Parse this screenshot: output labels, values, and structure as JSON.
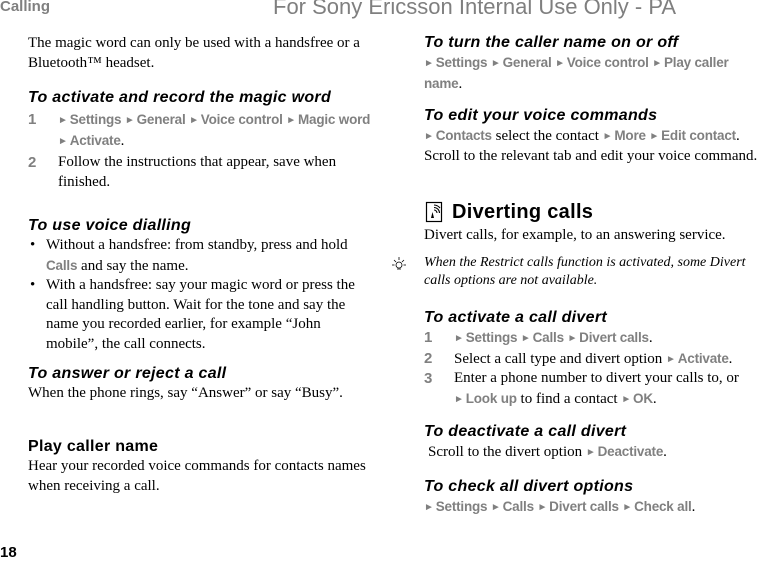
{
  "header": {
    "section": "Calling",
    "watermark": "For Sony Ericsson Internal Use Only - PA"
  },
  "footer": {
    "page_number": "18"
  },
  "left": {
    "intro": "The magic word can only be used with a handsfree or a Bluetooth™ headset.",
    "activate_magic": {
      "heading": "To activate and record the magic word",
      "step1": {
        "num": "1",
        "items": [
          "Settings",
          "General",
          "Voice control",
          "Magic word",
          "Activate"
        ],
        "end": "."
      },
      "step2": {
        "num": "2",
        "text": "Follow the instructions that appear, save when finished."
      }
    },
    "voice_dialling": {
      "heading": "To use voice dialling",
      "bullet": "•",
      "b1_pre": "Without a handsfree: from standby, press and hold ",
      "b1_key": "Calls",
      "b1_post": " and say the name.",
      "b2": "With a handsfree: say your magic word or press the call handling button. Wait for the tone and say the name you recorded earlier, for example “John mobile”, the call connects."
    },
    "answer_reject": {
      "heading": "To answer or reject a call",
      "text": "When the phone rings, say “Answer” or say “Busy”."
    },
    "play_caller": {
      "heading": "Play caller name",
      "text": "Hear your recorded voice commands for contacts names when receiving a call."
    }
  },
  "right": {
    "caller_name_toggle": {
      "heading": "To turn the caller name on or off",
      "items": [
        "Settings",
        "General",
        "Voice control",
        "Play caller name"
      ],
      "end": "."
    },
    "edit_commands": {
      "heading": "To edit your voice commands",
      "contacts": "Contacts",
      "mid": " select the contact ",
      "more": "More",
      "edit": "Edit contact",
      "end": ".",
      "text": "Scroll to the relevant tab and edit your voice command."
    },
    "diverting": {
      "heading": "Diverting calls",
      "icon": "network-service-icon",
      "text": "Divert calls, for example, to an answering service.",
      "note": "When the Restrict calls function is activated, some Divert calls options are not available."
    },
    "activate_divert": {
      "heading": "To activate a call divert",
      "step1": {
        "num": "1",
        "items": [
          "Settings",
          "Calls",
          "Divert calls"
        ],
        "end": "."
      },
      "step2": {
        "num": "2",
        "text": "Select a call type and divert option ",
        "key": "Activate",
        "end": "."
      },
      "step3": {
        "num": "3",
        "text": "Enter a phone number to divert your calls to, or ",
        "key": "Look up",
        "mid": " to find a contact ",
        "ok": "OK",
        "end": "."
      }
    },
    "deactivate_divert": {
      "heading": "To deactivate a call divert",
      "text": "Scroll to the divert option ",
      "key": "Deactivate",
      "end": "."
    },
    "check_divert": {
      "heading": "To check all divert options",
      "items": [
        "Settings",
        "Calls",
        "Divert calls",
        "Check all"
      ],
      "end": "."
    }
  },
  "glyphs": {
    "arrow": "►"
  }
}
